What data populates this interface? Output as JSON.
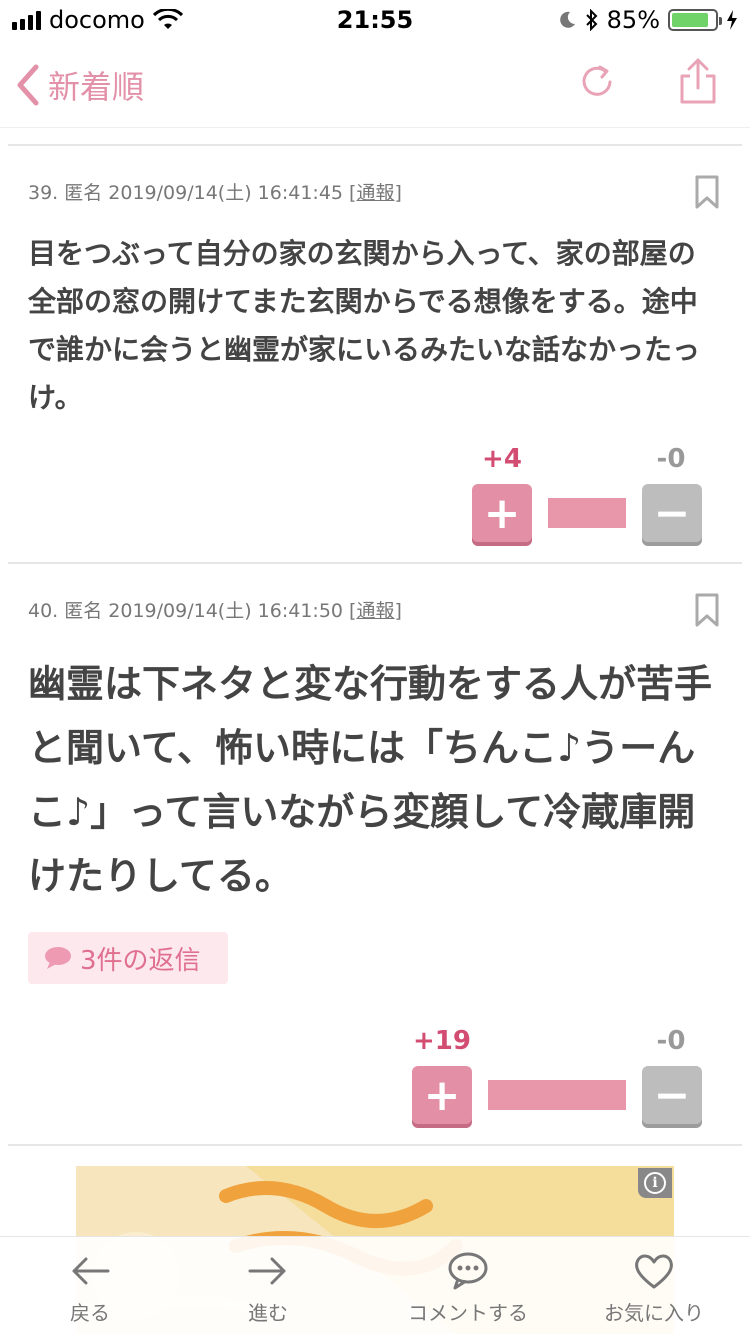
{
  "status": {
    "carrier": "docomo",
    "time": "21:55",
    "battery": "85%",
    "battery_level": 0.85
  },
  "nav": {
    "back_label": "新着順"
  },
  "comments": [
    {
      "meta_prefix": "39. 匿名 2019/09/14(土) 16:41:45 [",
      "report": "通報",
      "meta_suffix": "]",
      "text": "目をつぶって自分の家の玄関から入って、家の部屋の全部の窓の開けてまた玄関からでる想像をする。途中で誰かに会うと幽霊が家にいるみたいな話なかったっけ。",
      "plus": "+4",
      "minus": "-0",
      "plus_ratio": 1.0
    },
    {
      "meta_prefix": "40. 匿名 2019/09/14(土) 16:41:50 [",
      "report": "通報",
      "meta_suffix": "]",
      "text": "幽霊は下ネタと変な行動をする人が苦手と聞いて、怖い時には「ちんこ♪うーんこ♪」って言いながら変顔して冷蔵庫開けたりしてる。",
      "replies": "3件の返信",
      "plus": "+19",
      "minus": "-0",
      "plus_ratio": 1.0
    }
  ],
  "vote_buttons": {
    "plus": "+",
    "minus": "−"
  },
  "ad": {
    "info": "i"
  },
  "toolbar": {
    "back": "戻る",
    "forward": "進む",
    "comment": "コメントする",
    "favorite": "お気に入り"
  },
  "colors": {
    "accent_pink": "#e391a8",
    "plus_count": "#d34c72",
    "minus_gray": "#bdbdbd"
  }
}
